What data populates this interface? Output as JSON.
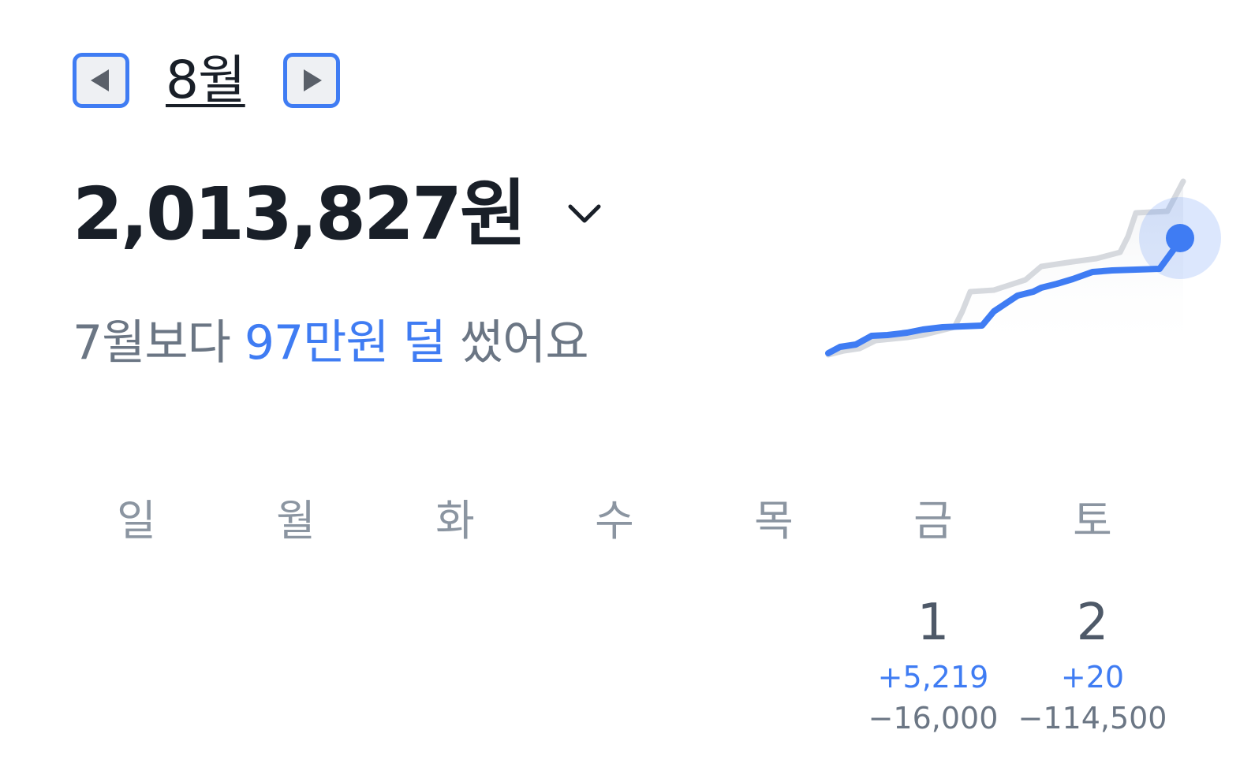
{
  "header": {
    "month_label": "8월",
    "prev_icon": "triangle-left-icon",
    "next_icon": "triangle-right-icon"
  },
  "summary": {
    "total_amount": "2,013,827원",
    "compare_prefix": "7월보다",
    "compare_amount": "97만원 덜",
    "compare_suffix": "썼어요"
  },
  "trend_colors": {
    "this_month": "#3f7cf3",
    "last_month": "#d6d9de"
  },
  "calendar": {
    "weekdays": [
      "일",
      "월",
      "화",
      "수",
      "목",
      "금",
      "토"
    ],
    "days": [
      {
        "date": "1",
        "income": "+5,219",
        "expense": "−16,000"
      },
      {
        "date": "2",
        "income": "+20",
        "expense": "−114,500"
      }
    ]
  }
}
